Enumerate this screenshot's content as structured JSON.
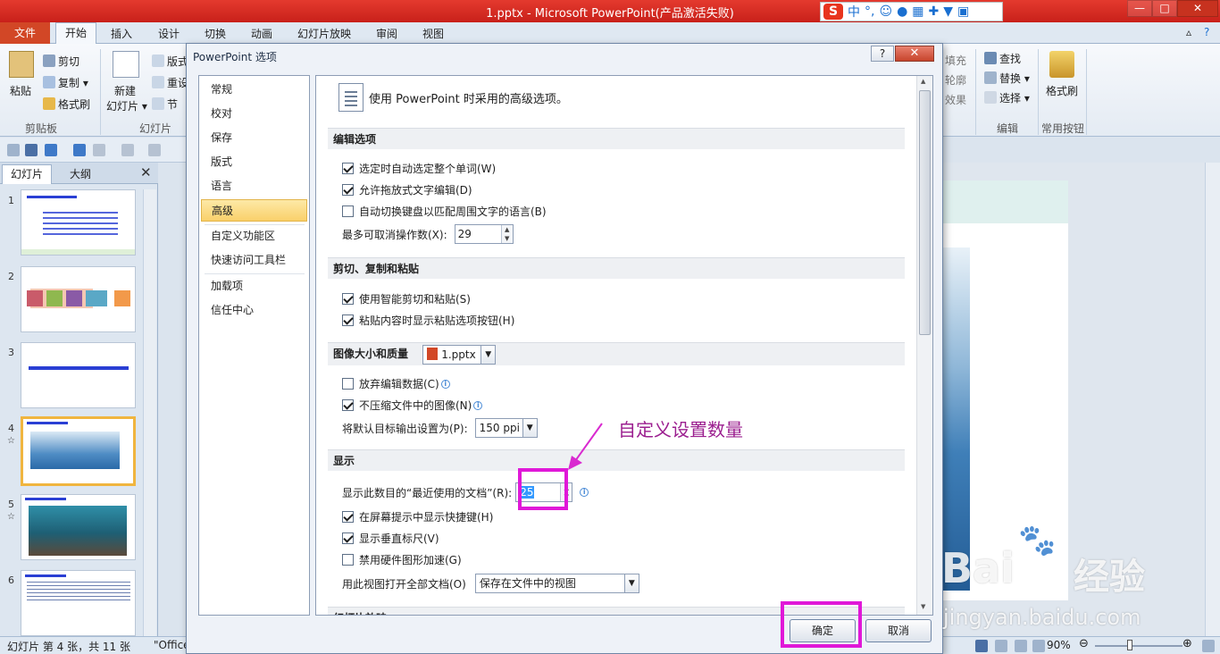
{
  "window": {
    "title": "1.pptx - Microsoft PowerPoint(产品激活失败)",
    "ime": {
      "logo": "S",
      "lang": "中"
    }
  },
  "ribbon": {
    "tabs": [
      "文件",
      "开始",
      "插入",
      "设计",
      "切换",
      "动画",
      "幻灯片放映",
      "审阅",
      "视图"
    ],
    "clipboard": {
      "paste": "粘贴",
      "cut": "剪切",
      "copy": "复制",
      "format_painter": "格式刷",
      "group": "剪贴板"
    },
    "slides": {
      "new_slide_1": "新建",
      "new_slide_2": "幻灯片",
      "layout": "版式",
      "reset": "重设",
      "section": "节",
      "group": "幻灯片"
    },
    "right_partial": {
      "fill": "填充",
      "outline": "轮廓",
      "effect": "效果"
    },
    "editing": {
      "find": "查找",
      "replace": "替换",
      "select": "选择",
      "group": "编辑"
    },
    "common": {
      "format_painter": "格式刷",
      "group": "常用按钮"
    }
  },
  "leftpane": {
    "tab_slides": "幻灯片",
    "tab_outline": "大纲",
    "close": "✕",
    "thumbnails": [
      "1",
      "2",
      "3",
      "4",
      "5",
      "6"
    ]
  },
  "statusbar": {
    "slide_info": "幻灯片 第 4 张，共 11 张",
    "theme": "\"Office",
    "zoom": "90%"
  },
  "dialog": {
    "title": "PowerPoint 选项",
    "help": "?",
    "close": "✕",
    "nav": [
      "常规",
      "校对",
      "保存",
      "版式",
      "语言",
      "高级",
      "自定义功能区",
      "快速访问工具栏",
      "加载项",
      "信任中心"
    ],
    "header": "使用 PowerPoint 时采用的高级选项。",
    "sections": {
      "editing": {
        "title": "编辑选项",
        "opt1": "选定时自动选定整个单词(W)",
        "opt2": "允许拖放式文字编辑(D)",
        "opt3": "自动切换键盘以匹配周围文字的语言(B)",
        "undo_label": "最多可取消操作数(X):",
        "undo_value": "29"
      },
      "cut": {
        "title": "剪切、复制和粘贴",
        "opt1": "使用智能剪切和粘贴(S)",
        "opt2": "粘贴内容时显示粘贴选项按钮(H)"
      },
      "image": {
        "title": "图像大小和质量",
        "file": "1.pptx",
        "opt1": "放弃编辑数据(C)",
        "opt2": "不压缩文件中的图像(N)",
        "ppi_label": "将默认目标输出设置为(P):",
        "ppi_value": "150 ppi"
      },
      "display": {
        "title": "显示",
        "recent_label": "显示此数目的“最近使用的文档”(R):",
        "recent_value": "25",
        "opt1": "在屏幕提示中显示快捷键(H)",
        "opt2": "显示垂直标尺(V)",
        "opt3": "禁用硬件图形加速(G)",
        "view_label": "用此视图打开全部文档(O)",
        "view_value": "保存在文件中的视图"
      },
      "slideshow": {
        "title": "幻灯片放映"
      }
    },
    "ok": "确定",
    "cancel": "取消"
  },
  "annotation": "自定义设置数量",
  "watermark": {
    "brand": "Bai",
    "cn": "经验",
    "url": "jingyan.baidu.com"
  }
}
